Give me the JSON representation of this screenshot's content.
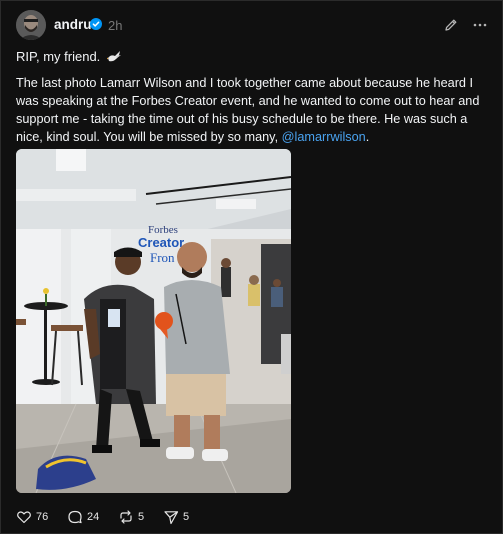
{
  "post": {
    "author": "andru",
    "verified": true,
    "time": "2h",
    "first_line": "RIP, my friend.",
    "body_before_mention": "The last photo Lamarr Wilson and I took together came about because he heard I was speaking at the Forbes Creator event, and he wanted to come out to hear and support me - taking the time out of his busy schedule to be there. He was such a nice, kind soul. You will be missed by so many, ",
    "mention": "@lamarrwilson",
    "body_after_mention": ".",
    "photo": {
      "sign_line1": "Forbes",
      "sign_line2": "Creator",
      "sign_line3": "Fron"
    }
  },
  "actions": {
    "likes": "76",
    "replies": "24",
    "reposts": "5",
    "shares": "5"
  },
  "icons": {
    "verified": "verified-badge-icon",
    "edit": "pencil-icon",
    "more": "more-horizontal-icon",
    "emoji": "dove-icon",
    "like": "heart-icon",
    "reply": "comment-icon",
    "repost": "repost-icon",
    "share": "send-icon"
  },
  "colors": {
    "background": "#101010",
    "text": "#f3f5f7",
    "muted": "#777777",
    "mention": "#4aa3f0",
    "verified": "#0095f6"
  }
}
